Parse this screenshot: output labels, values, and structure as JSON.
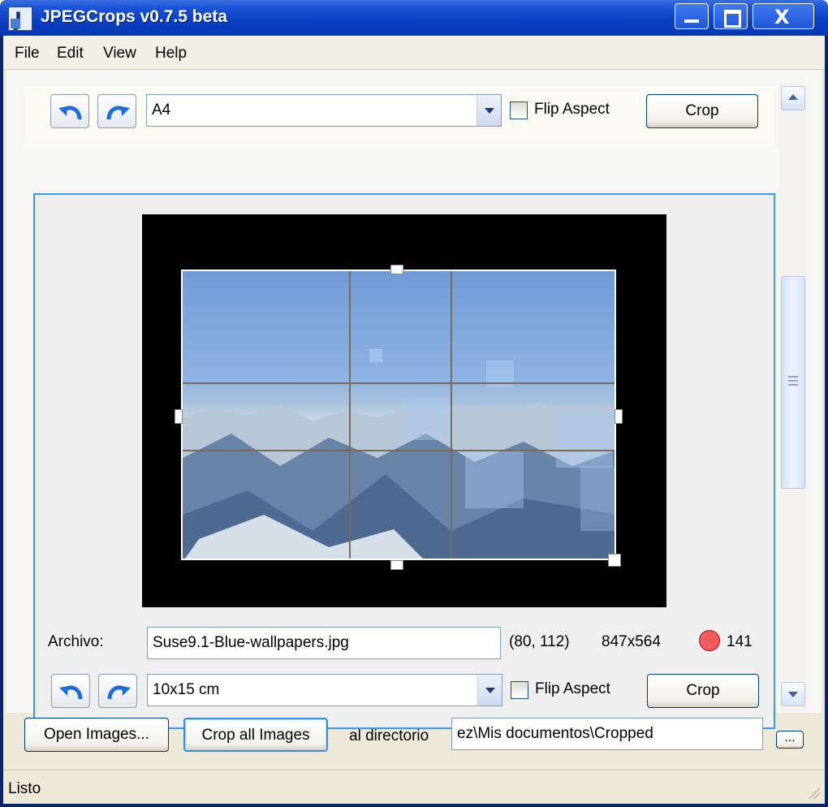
{
  "window": {
    "title": "JPEGCrops v0.7.5 beta",
    "close_glyph": "X"
  },
  "menu": [
    "File",
    "Edit",
    "View",
    "Help"
  ],
  "top_toolbar": {
    "format": "A4",
    "flip_label": "Flip Aspect",
    "crop_label": "Crop"
  },
  "image_panel": {
    "file_label": "Archivo:",
    "filename": "Suse9.1-Blue-wallpapers.jpg",
    "offset": "(80, 112)",
    "size": "847x564",
    "count": "141",
    "format": "10x15 cm",
    "flip_label": "Flip Aspect",
    "crop_label": "Crop"
  },
  "bottom": {
    "open_label": "Open Images...",
    "crop_all_label": "Crop all Images",
    "dir_label": "al directorio",
    "dir_value": "ez\\Mis documentos\\Cropped",
    "browse_label": "..."
  },
  "status": {
    "text": "Listo"
  },
  "colors": {
    "accent": "#3399ff",
    "titlebar": "#0a3fc4",
    "status_dot": "#ee5c5c"
  }
}
